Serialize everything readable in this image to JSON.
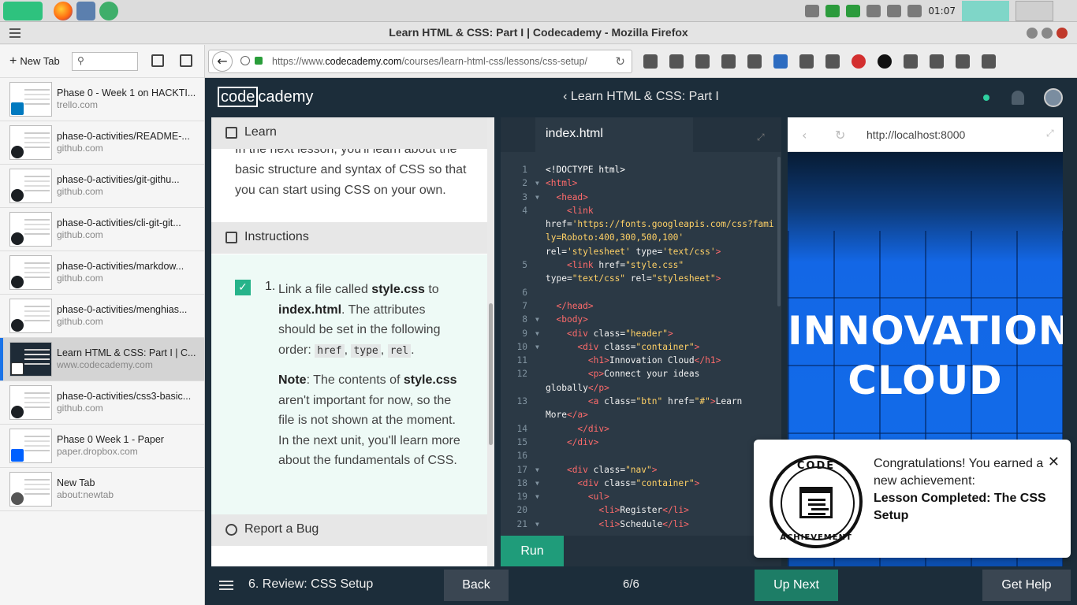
{
  "os": {
    "clock": "01:07"
  },
  "window": {
    "title": "Learn HTML & CSS: Part I | Codecademy - Mozilla Firefox"
  },
  "sidebar": {
    "new_tab_label": "New Tab",
    "search_placeholder": "",
    "tabs": [
      {
        "title": "Phase 0 - Week 1 on HACKTI...",
        "url": "trello.com",
        "favicon": "trello-icon"
      },
      {
        "title": "phase-0-activities/README-...",
        "url": "github.com",
        "favicon": "github-icon"
      },
      {
        "title": "phase-0-activities/git-githu...",
        "url": "github.com",
        "favicon": "github-icon"
      },
      {
        "title": "phase-0-activities/cli-git-git...",
        "url": "github.com",
        "favicon": "github-icon"
      },
      {
        "title": "phase-0-activities/markdow...",
        "url": "github.com",
        "favicon": "github-icon"
      },
      {
        "title": "phase-0-activities/menghias...",
        "url": "github.com",
        "favicon": "github-icon"
      },
      {
        "title": "Learn HTML & CSS: Part I | C...",
        "url": "www.codecademy.com",
        "favicon": "codecademy-icon",
        "active": true
      },
      {
        "title": "phase-0-activities/css3-basic...",
        "url": "github.com",
        "favicon": "github-icon"
      },
      {
        "title": "Phase 0 Week 1 - Paper",
        "url": "paper.dropbox.com",
        "favicon": "dropbox-icon"
      },
      {
        "title": "New Tab",
        "url": "about:newtab",
        "favicon": "firefox-icon"
      }
    ]
  },
  "navbar": {
    "url_prefix": "https://www.",
    "url_domain": "codecademy.com",
    "url_rest": "/courses/learn-html-css/lessons/css-setup/"
  },
  "codecademy": {
    "logo_code": "code",
    "logo_rest": "cademy",
    "breadcrumb": "Learn HTML & CSS: Part I",
    "learn_header": "Learn",
    "intro_text": "In the next lesson, you'll learn about the basic structure and syntax of CSS so that you can start using CSS on your own.",
    "instructions_header": "Instructions",
    "step_number": "1.",
    "step": {
      "t1": "Link a file called ",
      "b1": "style.css",
      "t2": " to ",
      "b2": "index.html",
      "t3": ". The attributes should be set in the following order: ",
      "c1": "href",
      "sep1": ", ",
      "c2": "type",
      "sep2": ", ",
      "c3": "rel",
      "t4": ".",
      "note_label": "Note",
      "n1": ": The contents of ",
      "nb": "style.css",
      "n2": " aren't important for now, so the file is not shown at the moment. In the next unit, you'll learn more about the fundamentals of CSS."
    },
    "report_bug": "Report a Bug",
    "editor_tab": "index.html",
    "run_label": "Run",
    "preview_url": "http://localhost:8000",
    "hero_line1": "INNOVATION",
    "hero_line2": "CLOUD",
    "bottom": {
      "lesson": "6. Review: CSS Setup",
      "back": "Back",
      "progress": "6/6",
      "next": "Up Next",
      "help": "Get Help"
    }
  },
  "code_lines": [
    {
      "n": "1",
      "fold": false,
      "html": "<span class=\"st\">&lt;!DOCTYPE html&gt;</span>"
    },
    {
      "n": "2",
      "fold": true,
      "html": "<span class=\"tg\">&lt;html&gt;</span>"
    },
    {
      "n": "3",
      "fold": true,
      "html": "  <span class=\"tg\">&lt;head&gt;</span>"
    },
    {
      "n": "4",
      "fold": false,
      "html": "    <span class=\"tg\">&lt;link</span>\nhref=<span class=\"at\">'https://fonts.googleapis.com/css?family=Roboto:400,300,500,100'</span>\nrel=<span class=\"at\">'stylesheet'</span> type=<span class=\"at\">'text/css'</span><span class=\"tg\">&gt;</span>"
    },
    {
      "n": "5",
      "fold": false,
      "html": "    <span class=\"tg\">&lt;link</span> href=<span class=\"at\">\"style.css\"</span>\ntype=<span class=\"at\">\"text/css\"</span> rel=<span class=\"at\">\"stylesheet\"</span><span class=\"tg\">&gt;</span>"
    },
    {
      "n": "6",
      "fold": false,
      "html": ""
    },
    {
      "n": "7",
      "fold": false,
      "html": "  <span class=\"tg\">&lt;/head&gt;</span>"
    },
    {
      "n": "8",
      "fold": true,
      "html": "  <span class=\"tg\">&lt;body&gt;</span>"
    },
    {
      "n": "9",
      "fold": true,
      "html": "    <span class=\"tg\">&lt;div</span> class=<span class=\"at\">\"header\"</span><span class=\"tg\">&gt;</span>"
    },
    {
      "n": "10",
      "fold": true,
      "html": "      <span class=\"tg\">&lt;div</span> class=<span class=\"at\">\"container\"</span><span class=\"tg\">&gt;</span>"
    },
    {
      "n": "11",
      "fold": false,
      "html": "        <span class=\"tg\">&lt;h1&gt;</span>Innovation Cloud<span class=\"tg\">&lt;/h1&gt;</span>"
    },
    {
      "n": "12",
      "fold": false,
      "html": "        <span class=\"tg\">&lt;p&gt;</span>Connect your ideas\nglobally<span class=\"tg\">&lt;/p&gt;</span>"
    },
    {
      "n": "13",
      "fold": false,
      "html": "        <span class=\"tg\">&lt;a</span> class=<span class=\"at\">\"btn\"</span> href=<span class=\"at\">\"#\"</span><span class=\"tg\">&gt;</span>Learn\nMore<span class=\"tg\">&lt;/a&gt;</span>"
    },
    {
      "n": "14",
      "fold": false,
      "html": "      <span class=\"tg\">&lt;/div&gt;</span>"
    },
    {
      "n": "15",
      "fold": false,
      "html": "    <span class=\"tg\">&lt;/div&gt;</span>"
    },
    {
      "n": "16",
      "fold": false,
      "html": ""
    },
    {
      "n": "17",
      "fold": true,
      "html": "    <span class=\"tg\">&lt;div</span> class=<span class=\"at\">\"nav\"</span><span class=\"tg\">&gt;</span>"
    },
    {
      "n": "18",
      "fold": true,
      "html": "      <span class=\"tg\">&lt;div</span> class=<span class=\"at\">\"container\"</span><span class=\"tg\">&gt;</span>"
    },
    {
      "n": "19",
      "fold": true,
      "html": "        <span class=\"tg\">&lt;ul&gt;</span>"
    },
    {
      "n": "20",
      "fold": false,
      "html": "          <span class=\"tg\">&lt;li&gt;</span>Register<span class=\"tg\">&lt;/li&gt;</span>"
    },
    {
      "n": "21",
      "fold": true,
      "html": "          <span class=\"tg\">&lt;li&gt;</span>Schedule<span class=\"tg\">&lt;/li&gt;</span>"
    }
  ],
  "toast": {
    "badge_top": "CODE",
    "badge_bottom": "ACHIEVEMENT",
    "message": "Congratulations! You earned a new achievement:",
    "achievement": "Lesson Completed: The CSS Setup",
    "close": "✕"
  },
  "colors": {
    "accent": "#1f9c7a",
    "page_bg": "#1c2d3a",
    "editor_bg": "#2b3945",
    "preview_blue": "#1367e6"
  }
}
